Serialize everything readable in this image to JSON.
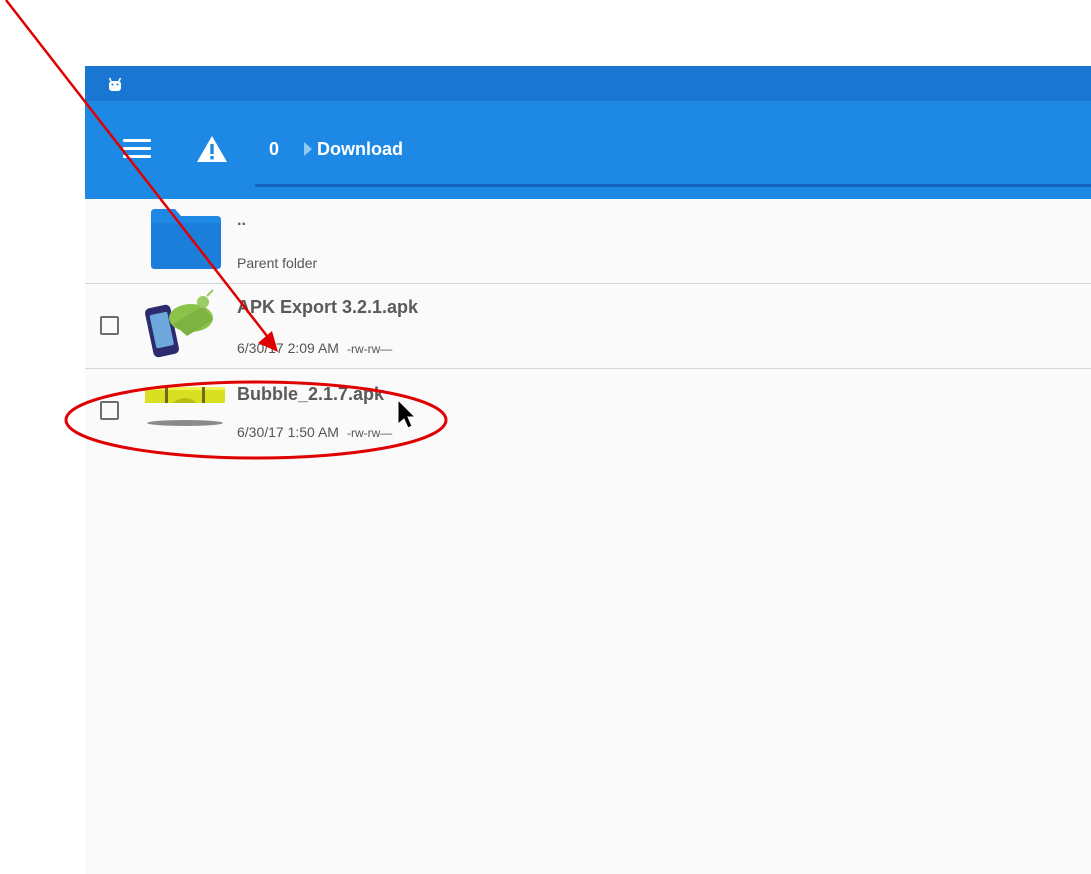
{
  "toolbar": {
    "breadcrumb_root": "0",
    "breadcrumb_current": "Download"
  },
  "files": {
    "parent": {
      "name": "..",
      "subtitle": "Parent folder"
    },
    "items": [
      {
        "name": "APK Export 3.2.1.apk",
        "date": "6/30/17 2:09 AM",
        "permissions": "-rw-rw—"
      },
      {
        "name": "Bubble_2.1.7.apk",
        "date": "6/30/17 1:50 AM",
        "permissions": "-rw-rw—"
      }
    ]
  },
  "colors": {
    "status_bar": "#1976d2",
    "toolbar": "#1e88e5",
    "folder": "#1e88e5",
    "annotation": "#e00000"
  },
  "icons": [
    "android-icon",
    "menu-icon",
    "warning-icon",
    "breadcrumb-arrow-icon",
    "folder-icon",
    "apk-export-icon",
    "bubble-level-icon",
    "mouse-cursor-icon"
  ]
}
